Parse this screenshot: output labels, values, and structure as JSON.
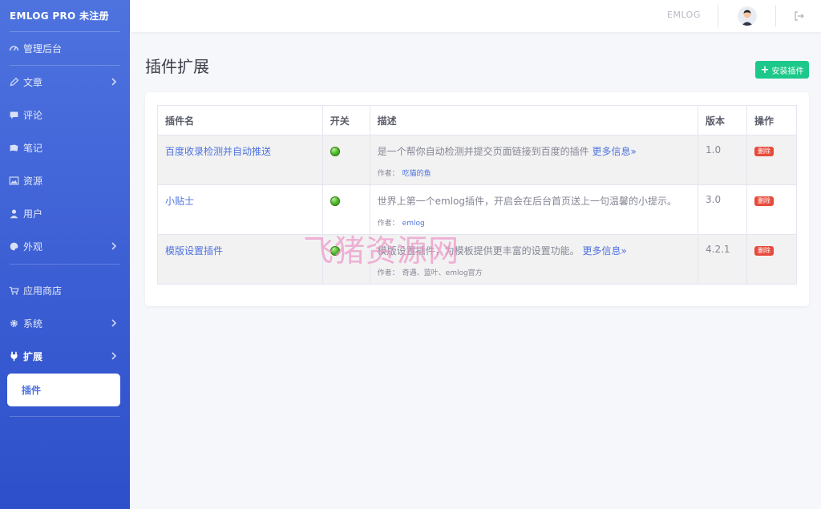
{
  "sidebar": {
    "brand": "EMLOG PRO 未注册",
    "items": [
      {
        "label": "管理后台"
      },
      {
        "label": "文章"
      },
      {
        "label": "评论"
      },
      {
        "label": "笔记"
      },
      {
        "label": "资源"
      },
      {
        "label": "用户"
      },
      {
        "label": "外观"
      },
      {
        "label": "应用商店"
      },
      {
        "label": "系统"
      },
      {
        "label": "扩展"
      }
    ],
    "sub_active": "插件"
  },
  "topbar": {
    "brand": "EMLOG"
  },
  "page": {
    "title": "插件扩展",
    "install_label": "安装插件"
  },
  "table": {
    "headers": [
      "插件名",
      "开关",
      "描述",
      "版本",
      "操作"
    ],
    "rows": [
      {
        "name": "百度收录检测并自动推送",
        "desc": "是一个帮你自动检测并提交页面链接到百度的插件",
        "more": "更多信息»",
        "author_label": "作者：",
        "author": "吃猫的鱼",
        "version": "1.0",
        "action": "删除"
      },
      {
        "name": "小贴士",
        "desc": "世界上第一个emlog插件，开启会在后台首页送上一句温馨的小提示。",
        "more": "",
        "author_label": "作者：",
        "author": "emlog",
        "version": "3.0",
        "action": "删除"
      },
      {
        "name": "模版设置插件",
        "desc": "模版设置插件，为模板提供更丰富的设置功能。",
        "more": "更多信息»",
        "author_label": "作者：",
        "author": "奇遇、蓝叶、emlog官方",
        "version": "4.2.1",
        "action": "删除"
      }
    ]
  },
  "watermark": "飞猪资源网",
  "colors": {
    "sidebar": "#4e73df",
    "accent": "#4e73df",
    "success": "#1cc88a",
    "danger": "#e74a3b"
  }
}
